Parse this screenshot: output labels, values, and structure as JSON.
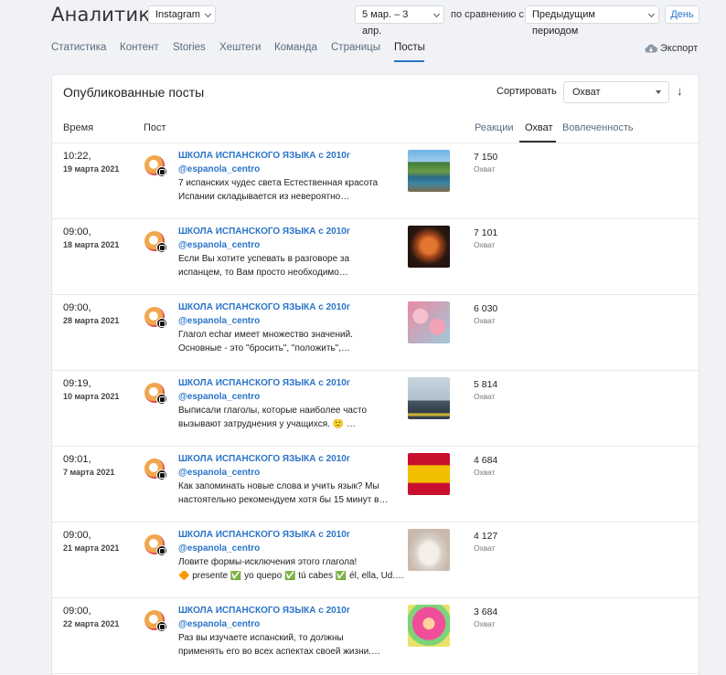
{
  "header": {
    "title": "Аналитика",
    "source": "Instagram",
    "period": "5 мар. – 3 апр.",
    "compare_label": "по сравнению с",
    "compare_value": "Предыдущим периодом",
    "granularity": "День"
  },
  "tabs": [
    {
      "label": "Статистика"
    },
    {
      "label": "Контент"
    },
    {
      "label": "Stories"
    },
    {
      "label": "Хештеги"
    },
    {
      "label": "Команда"
    },
    {
      "label": "Страницы"
    },
    {
      "label": "Посты",
      "active": true
    }
  ],
  "export_label": "Экспорт",
  "card": {
    "title": "Опубликованные посты",
    "sort_label": "Сортировать",
    "sort_value": "Охват",
    "sort_direction_icon": "↓"
  },
  "table": {
    "col_time": "Время",
    "col_post": "Пост",
    "metric_tabs": [
      "Реакции",
      "Охват",
      "Вовлеченность"
    ],
    "active_metric": "Охват"
  },
  "posts": [
    {
      "time": "10:22,",
      "date": "19 марта 2021",
      "author": "ШКОЛА ИСПАНСКОГО ЯЗЫКА с 2010г",
      "handle": "@espanola_centro",
      "line1": "7 испанских чудес света    Естественная красота",
      "line2": "Испании складывается из невероятно…",
      "value": "7 150",
      "metric_label": "Охват"
    },
    {
      "time": "09:00,",
      "date": "18 марта 2021",
      "author": "ШКОЛА ИСПАНСКОГО ЯЗЫКА с 2010г",
      "handle": "@espanola_centro",
      "line1": "Если Вы хотите успевать в разговоре за",
      "line2": "испанцем, то Вам просто необходимо…",
      "value": "7 101",
      "metric_label": "Охват"
    },
    {
      "time": "09:00,",
      "date": "28 марта 2021",
      "author": "ШКОЛА ИСПАНСКОГО ЯЗЫКА с 2010г",
      "handle": "@espanola_centro",
      "line1": "Глагол echar имеет множество значений.",
      "line2": "Основные - это \"бросить\", \"положить\",…",
      "value": "6 030",
      "metric_label": "Охват"
    },
    {
      "time": "09:19,",
      "date": "10 марта 2021",
      "author": "ШКОЛА ИСПАНСКОГО ЯЗЫКА с 2010г",
      "handle": "@espanola_centro",
      "line1": "Выписали глаголы, которые наиболее часто",
      "line2": "вызывают затруднения у учащихся. 🙂 …",
      "value": "5 814",
      "metric_label": "Охват"
    },
    {
      "time": "09:01,",
      "date": "7 марта 2021",
      "author": "ШКОЛА ИСПАНСКОГО ЯЗЫКА с 2010г",
      "handle": "@espanola_centro",
      "line1": "Как запоминать новые слова и учить язык? Мы",
      "line2": "настоятельно рекомендуем хотя бы 15 минут в…",
      "value": "4 684",
      "metric_label": "Охват"
    },
    {
      "time": "09:00,",
      "date": "21 марта 2021",
      "author": "ШКОЛА ИСПАНСКОГО ЯЗЫКА с 2010г",
      "handle": "@espanola_centro",
      "line1": "Ловите формы-исключения этого глагола!",
      "line2": "🔶 presente ✅ yo quepo ✅ tú cabes ✅ él, ella, Ud.…",
      "value": "4 127",
      "metric_label": "Охват"
    },
    {
      "time": "09:00,",
      "date": "22 марта 2021",
      "author": "ШКОЛА ИСПАНСКОГО ЯЗЫКА с 2010г",
      "handle": "@espanola_centro",
      "line1": "Раз вы изучаете испанский, то должны",
      "line2": "применять его во всех аспектах своей жизни.…",
      "value": "3 684",
      "metric_label": "Охват"
    }
  ],
  "colors": {
    "accent": "#2a74c8",
    "background": "#f0f2f5"
  }
}
